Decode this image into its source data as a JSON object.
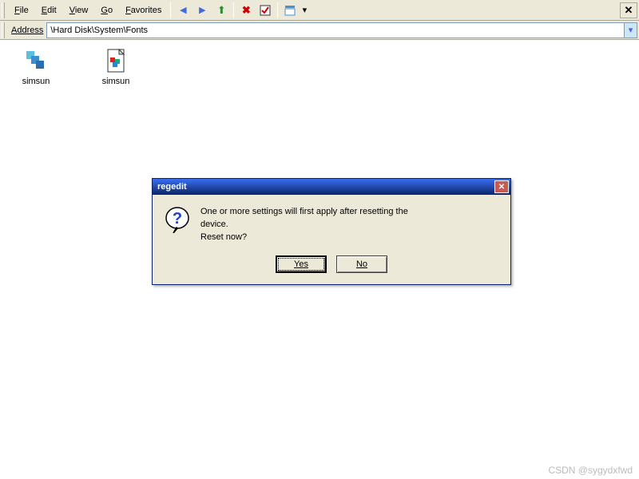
{
  "menubar": {
    "file": "File",
    "edit": "Edit",
    "view": "View",
    "go": "Go",
    "favorites": "Favorites"
  },
  "toolbar": {
    "back": "◀",
    "forward": "▶",
    "up": "⬆",
    "delete": "✖",
    "check": "✔",
    "view": "▤",
    "viewdrop": "▾"
  },
  "window_close": "✕",
  "addressbar": {
    "label_prefix": "A",
    "label_rest": "ddress",
    "path": "\\Hard Disk\\System\\Fonts",
    "drop": "▾"
  },
  "files": [
    {
      "name": "simsun"
    },
    {
      "name": "simsun"
    }
  ],
  "dialog": {
    "title": "regedit",
    "close": "✕",
    "line1": "One or more settings will first apply after resetting the",
    "line2": "device.",
    "line3": "Reset now?",
    "yes": "Yes",
    "no": "No"
  },
  "watermark": "CSDN @sygydxfwd"
}
